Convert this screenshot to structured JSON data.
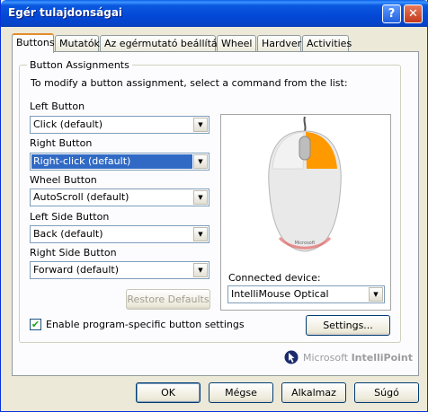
{
  "window": {
    "title": "Egér tulajdonságai",
    "help_glyph": "?",
    "close_glyph": "✕"
  },
  "tabs": [
    {
      "label": "Buttons",
      "active": true
    },
    {
      "label": "Mutatók",
      "active": false
    },
    {
      "label": "Az egérmutató beállításai",
      "active": false
    },
    {
      "label": "Wheel",
      "active": false
    },
    {
      "label": "Hardver",
      "active": false
    },
    {
      "label": "Activities",
      "active": false
    }
  ],
  "assignments": {
    "group_title": "Button Assignments",
    "instructions": "To modify a button assignment, select a command from the list:",
    "fields": [
      {
        "label": "Left Button",
        "value": "Click (default)",
        "selected": false
      },
      {
        "label": "Right Button",
        "value": "Right-click (default)",
        "selected": true
      },
      {
        "label": "Wheel Button",
        "value": "AutoScroll (default)",
        "selected": false
      },
      {
        "label": "Left Side Button",
        "value": "Back (default)",
        "selected": false
      },
      {
        "label": "Right Side Button",
        "value": "Forward (default)",
        "selected": false
      }
    ],
    "restore_label": "Restore Defaults",
    "connected_device_label": "Connected device:",
    "connected_device_value": "IntelliMouse Optical",
    "settings_label": "Settings...",
    "program_specific_label": "Enable program-specific button settings",
    "program_specific_checked": true,
    "brand_prefix": "Microsoft",
    "brand_name": "IntelliPoint"
  },
  "footer": {
    "ok_label": "OK",
    "cancel_label": "Mégse",
    "apply_label": "Alkalmaz",
    "help_label": "Súgó"
  },
  "icons": {
    "help": "help-icon",
    "close": "close-icon",
    "dropdown": "chevron-down-icon",
    "check": "checkmark-icon",
    "logo": "intellipoint-logo-icon"
  },
  "colors": {
    "title_blue": "#0448d6",
    "selection": "#316ac5",
    "active_tab_accent": "#e68b2c",
    "mouse_highlight": "#ff9900"
  }
}
